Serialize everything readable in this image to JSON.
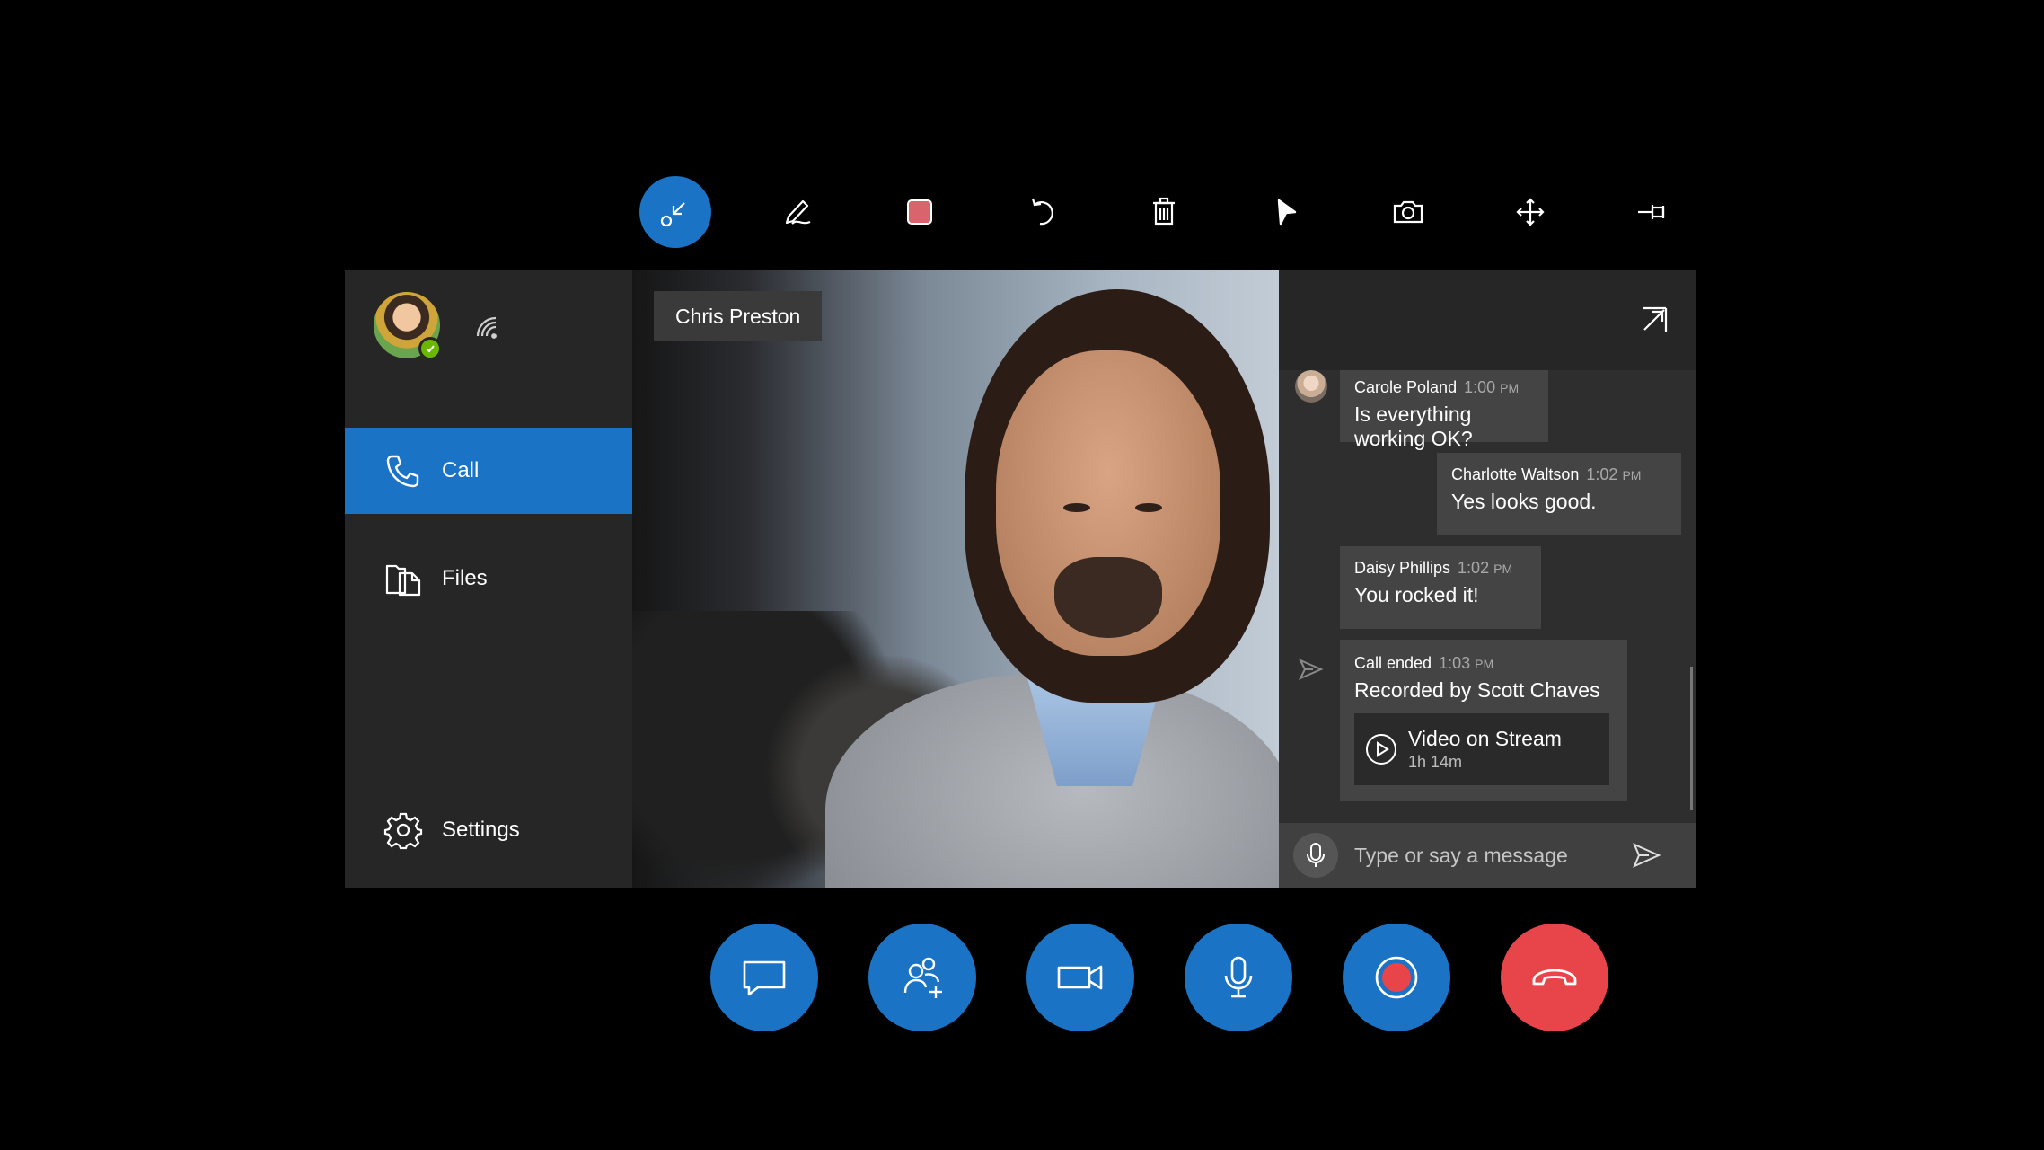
{
  "toolbar": {
    "tools": [
      {
        "id": "shrink",
        "icon": "minimize-arrow-icon",
        "active": true
      },
      {
        "id": "ink",
        "icon": "pen-icon"
      },
      {
        "id": "color",
        "icon": "color-swatch-icon",
        "color": "#d9646c"
      },
      {
        "id": "undo",
        "icon": "undo-icon"
      },
      {
        "id": "delete",
        "icon": "trash-icon"
      },
      {
        "id": "arrow",
        "icon": "arrow-pointer-icon"
      },
      {
        "id": "snapshot",
        "icon": "camera-icon"
      },
      {
        "id": "move",
        "icon": "move-icon"
      },
      {
        "id": "pin",
        "icon": "pin-icon"
      }
    ]
  },
  "sidebar": {
    "profile": {
      "avatar": "user-avatar",
      "status": "available"
    },
    "items": [
      {
        "label": "Call",
        "icon": "phone-icon",
        "selected": true
      },
      {
        "label": "Files",
        "icon": "files-icon"
      },
      {
        "label": "Settings",
        "icon": "gear-icon"
      }
    ]
  },
  "video": {
    "participant_name": "Chris Preston"
  },
  "chat": {
    "messages": [
      {
        "sender": "Carole Poland",
        "time": "1:00",
        "ampm": "PM",
        "text": "Is everything working OK?"
      },
      {
        "sender": "Charlotte Waltson",
        "time": "1:02",
        "ampm": "PM",
        "text": "Yes looks good."
      },
      {
        "sender": "Daisy Phillips",
        "time": "1:02",
        "ampm": "PM",
        "text": "You rocked it!"
      },
      {
        "sender": "Call ended",
        "time": "1:03",
        "ampm": "PM",
        "text": "Recorded by Scott Chaves",
        "recording": {
          "title": "Video on Stream",
          "duration": "1h 14m"
        }
      }
    ],
    "compose_placeholder": "Type or say a message"
  },
  "controls": [
    {
      "id": "chat",
      "icon": "chat-bubble-icon"
    },
    {
      "id": "add-people",
      "icon": "add-people-icon"
    },
    {
      "id": "video",
      "icon": "video-camera-icon"
    },
    {
      "id": "mute",
      "icon": "microphone-icon"
    },
    {
      "id": "record",
      "icon": "record-icon",
      "color": "#e8454a"
    },
    {
      "id": "hang-up",
      "icon": "hang-up-icon",
      "color": "#e8454a"
    }
  ],
  "colors": {
    "accent": "#1a73c5",
    "danger": "#e8454a",
    "presence": "#6bb700"
  }
}
